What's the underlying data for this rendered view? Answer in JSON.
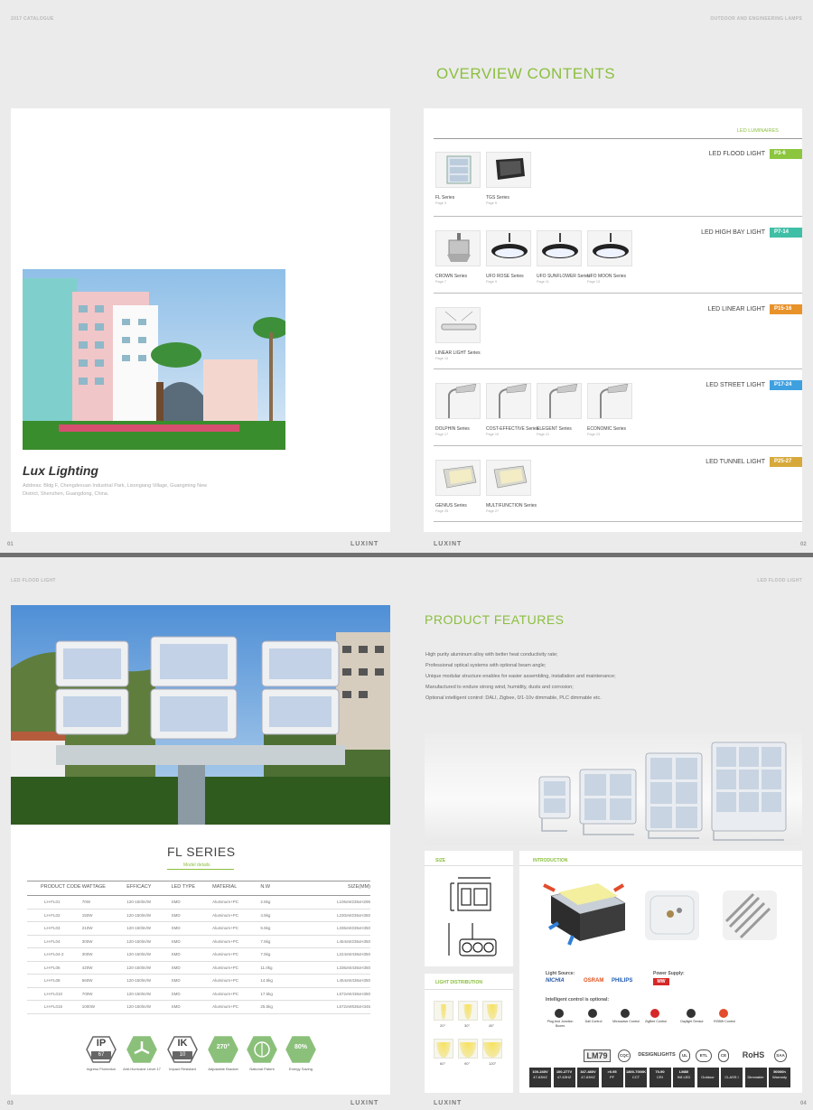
{
  "spread1": {
    "left_header": "2017 CATALOGUE",
    "right_header": "OUTDOOR AND ENGINEERING LAMPS",
    "page_left": "01",
    "page_right": "02",
    "brand": "LUXINT",
    "company": {
      "name": "Lux Lighting",
      "address_line1": "Address: Bldg F, Chengdexuan Industrial Park, Lisongiang Village, Guangming New",
      "address_line2": "District, Shenzhen, Guangdong, China."
    },
    "overview_title": "OVERVIEW CONTENTS",
    "section_label": "LED LUMINAIRES",
    "categories": [
      {
        "name": "LED FLOOD LIGHT",
        "pages": "P3-6",
        "color": "#8cc63f",
        "products": [
          {
            "name": "FL Series",
            "page": "Page  3"
          },
          {
            "name": "TGS Series",
            "page": "Page  5"
          }
        ]
      },
      {
        "name": "LED HIGH BAY LIGHT",
        "pages": "P7-14",
        "color": "#3fbfa6",
        "products": [
          {
            "name": "CROWN Series",
            "page": "Page  7"
          },
          {
            "name": "UFO ROSE Series",
            "page": "Page  9"
          },
          {
            "name": "UFO SUNFLOWER Series",
            "page": "Page  11"
          },
          {
            "name": "UFO MOON Series",
            "page": "Page  13"
          }
        ]
      },
      {
        "name": "LED LINEAR LIGHT",
        "pages": "P15-16",
        "color": "#e8922a",
        "products": [
          {
            "name": "LINEAR LIGHT Series",
            "page": "Page  15"
          }
        ]
      },
      {
        "name": "LED STREET LIGHT",
        "pages": "P17-24",
        "color": "#3fa0e0",
        "products": [
          {
            "name": "DOLPHIN Series",
            "page": "Page  17"
          },
          {
            "name": "COST-EFFECTIVE Series",
            "page": "Page  19"
          },
          {
            "name": "ELEGENT Series",
            "page": "Page  21"
          },
          {
            "name": "ECONOMIC Series",
            "page": "Page  23"
          }
        ]
      },
      {
        "name": "LED TUNNEL LIGHT",
        "pages": "P25-27",
        "color": "#d7a93a",
        "products": [
          {
            "name": "GENIUS Series",
            "page": "Page  25"
          },
          {
            "name": "MULTIFUNCTION Series",
            "page": "Page  27"
          }
        ]
      }
    ]
  },
  "spread2": {
    "left_header": "LED FLOOD LIGHT",
    "right_header": "LED FLOOD LIGHT",
    "page_left": "03",
    "page_right": "04",
    "brand": "LUXINT",
    "series_title": "FL SERIES",
    "series_subtitle": "Model details",
    "table": {
      "headers": [
        "PRODUCT  CODE",
        "WATTAGE",
        "EFFICACY",
        "LED TYPE",
        "MATERIAL",
        "N.W",
        "SIZE(MM)"
      ],
      "rows": [
        [
          "LH-FL01",
          "70W",
          "120-150lm/W",
          "SMD",
          "Aluminum+PC",
          "2.6kg",
          "L106xW236xH295"
        ],
        [
          "LH-FL02",
          "150W",
          "120-150lm/W",
          "SMD",
          "Aluminum+PC",
          "4.5kg",
          "L230xW236xH350"
        ],
        [
          "LH-FL03",
          "210W",
          "120-150lm/W",
          "SMD",
          "Aluminum+PC",
          "5.5kg",
          "L336xW236xH350"
        ],
        [
          "LH-FL04",
          "300W",
          "120-150lm/W",
          "SMD",
          "Aluminum+PC",
          "7.5kg",
          "L454xW236xH350"
        ],
        [
          "LH-FL04-2",
          "300W",
          "120-150lm/W",
          "SMD",
          "Aluminum+PC",
          "7.5kg",
          "L224xW436xH350"
        ],
        [
          "LH-FL06",
          "420W",
          "120-150lm/W",
          "SMD",
          "Aluminum+PC",
          "11.0kg",
          "L336xW436xH350"
        ],
        [
          "LH-FL08",
          "560W",
          "120-150lm/W",
          "SMD",
          "Aluminum+PC",
          "14.5kg",
          "L454xW436xH350"
        ],
        [
          "LH-FL010",
          "700W",
          "120-150lm/W",
          "SMD",
          "Aluminum+PC",
          "17.5kg",
          "L572xW436xH350"
        ],
        [
          "LH-FL015",
          "1000W",
          "120-150lm/W",
          "SMD",
          "Aluminum+PC",
          "25.5kg",
          "L572xW636xH345"
        ]
      ]
    },
    "feature_icons": [
      {
        "top": "IP",
        "bottom": "67",
        "label": "Ingress Protection"
      },
      {
        "top": "",
        "bottom": "",
        "label": "Anti-Hurricane Level 17"
      },
      {
        "top": "IK",
        "bottom": "10",
        "label": "Impact Resistant"
      },
      {
        "top": "270°",
        "bottom": "",
        "label": "Adjustable Bracket"
      },
      {
        "top": "",
        "bottom": "",
        "label": "National Patent"
      },
      {
        "top": "80%",
        "bottom": "",
        "label": "Energy Saving"
      }
    ],
    "features_title": "PRODUCT FEATURES",
    "features": [
      "High purity aluminum alloy with better heat conductivity rate;",
      "Professional optical systems with optional beam angle;",
      "Unique modular structure enables for easier assembling, installation and maintenance;",
      "Manufactured to endure strong wind, humidity, dusts and corrosion;",
      "Optional intelligent control: DALI, Zigbee, 0/1-10v dimmable, PLC dimmable etc."
    ],
    "size_title": "SIZE",
    "intro_title": "INTRODUCTION",
    "light_dist_title": "LIGHT DISTRIBUTION",
    "beam_angles": [
      "20°",
      "30°",
      "45°",
      "60°",
      "90°",
      "120°"
    ],
    "light_source_label": "Light Source:",
    "light_sources": [
      "NICHIA",
      "OSRAM",
      "PHILIPS"
    ],
    "power_supply_label": "Power Supply:",
    "power_supply": "MW",
    "intelligent_label": "Intelligent control is optional:",
    "controls": [
      "Plug And Junction Boxes",
      "Dali Control",
      "Microwave Control",
      "ZigBee Control",
      "Daylight Sensor",
      "RGBW Control"
    ],
    "certs": [
      "LM79",
      "CQC",
      "DESIGNLIGHTS",
      "UL",
      "ETL",
      "CE",
      "RoHS",
      "SAA"
    ],
    "spec_boxes": [
      [
        "100-240V",
        "47-63HZ"
      ],
      [
        "100-277V",
        "47-63HZ"
      ],
      [
        "347-480V",
        "47-63HZ"
      ],
      [
        ">0.95",
        "PF"
      ],
      [
        "1800-7000K",
        "CCT"
      ],
      [
        "70-90",
        "CRI"
      ],
      [
        "LM80",
        "9/8 LED"
      ],
      [
        "",
        "Outdoor"
      ],
      [
        "",
        "CLASS I"
      ],
      [
        "",
        "Dimmable"
      ],
      [
        "50000h",
        "Warranty"
      ]
    ]
  }
}
